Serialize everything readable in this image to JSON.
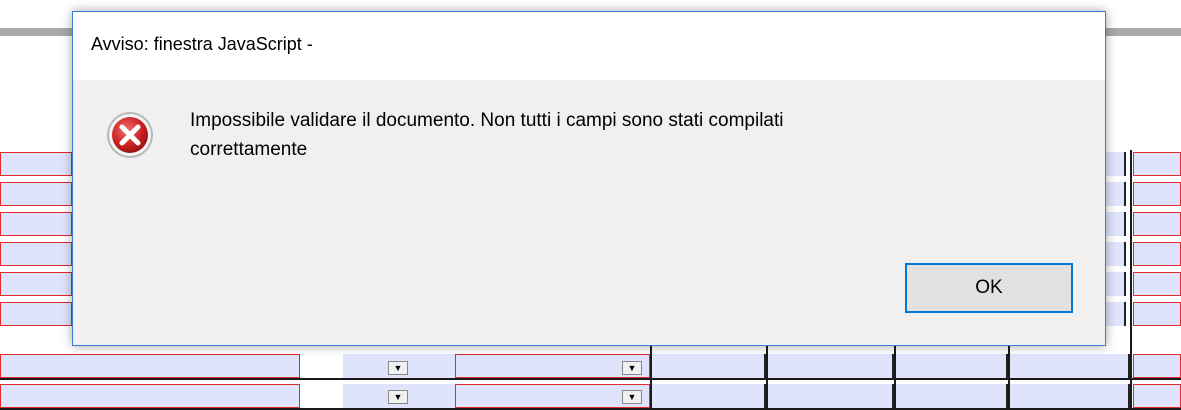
{
  "dialog": {
    "title": "Avviso: finestra JavaScript -",
    "message_line1": "Impossibile validare il documento. Non tutti i campi sono stati compilati",
    "message_line2": "correttamente",
    "ok_label": "OK",
    "icon": "error-icon"
  },
  "form": {
    "dropdown_glyph": "▼",
    "colors": {
      "field_border": "#e22a2a",
      "field_fill": "#dfe3fb",
      "dialog_border": "#3b7bd1",
      "button_focus": "#0078d7"
    }
  }
}
